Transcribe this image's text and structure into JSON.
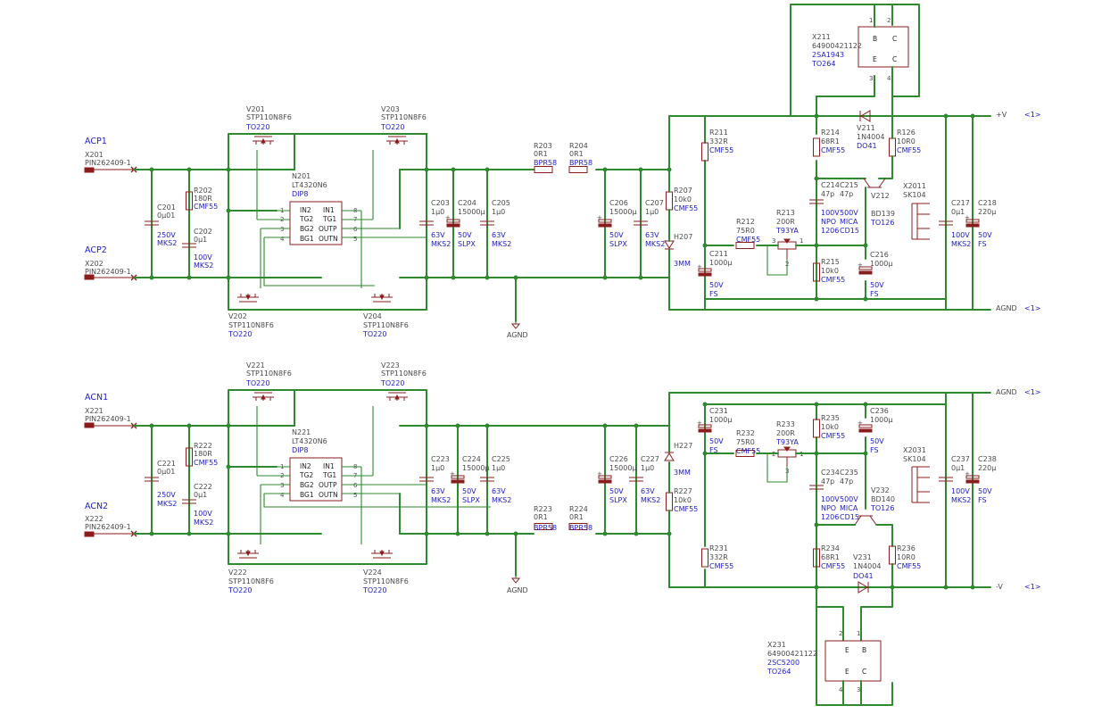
{
  "nets": {
    "acp1": "ACP1",
    "acp2": "ACP2",
    "acn1": "ACN1",
    "acn2": "ACN2",
    "pv": "+V",
    "nv": "-V",
    "agnd": "AGND",
    "ref": "<1>"
  },
  "connectors": {
    "x201": {
      "ref": "X201",
      "val": "PIN262409-1"
    },
    "x202": {
      "ref": "X202",
      "val": "PIN262409-1"
    },
    "x221": {
      "ref": "X221",
      "val": "PIN262409-1"
    },
    "x222": {
      "ref": "X222",
      "val": "PIN262409-1"
    }
  },
  "top": {
    "c201": {
      "ref": "C201",
      "val": "0µ01",
      "v": "250V",
      "t": "MKS2"
    },
    "r202": {
      "ref": "R202",
      "val": "180R",
      "t": "CMF55"
    },
    "c202": {
      "ref": "C202",
      "val": "0µ1",
      "v": "100V",
      "t": "MKS2"
    },
    "v201": {
      "ref": "V201",
      "val": "STP110N8F6",
      "t": "TO220"
    },
    "v202": {
      "ref": "V202",
      "val": "STP110N8F6",
      "t": "TO220"
    },
    "v203": {
      "ref": "V203",
      "val": "STP110N8F6",
      "t": "TO220"
    },
    "v204": {
      "ref": "V204",
      "val": "STP110N8F6",
      "t": "TO220"
    },
    "n201": {
      "ref": "N201",
      "val": "LT4320N6",
      "t": "DIP8",
      "pins": [
        "IN2",
        "TG2",
        "BG2",
        "BG1",
        "IN1",
        "TG1",
        "OUTP",
        "OUTN"
      ],
      "nums": [
        "1",
        "2",
        "3",
        "4",
        "8",
        "7",
        "6",
        "5"
      ]
    },
    "c203": {
      "ref": "C203",
      "val": "1µ0",
      "v": "63V",
      "t": "MKS2"
    },
    "c204": {
      "ref": "C204",
      "val": "15000µ",
      "v": "50V",
      "t": "SLPX"
    },
    "c205": {
      "ref": "C205",
      "val": "1µ0",
      "v": "63V",
      "t": "MKS2"
    },
    "r203": {
      "ref": "R203",
      "val": "0R1",
      "t": "BPR58"
    },
    "r204": {
      "ref": "R204",
      "val": "0R1",
      "t": "BPR58"
    },
    "c206": {
      "ref": "C206",
      "val": "15000µ",
      "v": "50V",
      "t": "SLPX"
    },
    "c207": {
      "ref": "C207",
      "val": "1µ0",
      "v": "63V",
      "t": "MKS2"
    },
    "r207": {
      "ref": "R207",
      "val": "10k0",
      "t": "CMF55"
    },
    "h207": {
      "ref": "H207",
      "t": "3MM"
    },
    "r211": {
      "ref": "R211",
      "val": "332R",
      "t": "CMF55"
    },
    "c211": {
      "ref": "C211",
      "val": "1000µ",
      "v": "50V",
      "t": "FS"
    },
    "r212": {
      "ref": "R212",
      "val": "75R0",
      "t": "CMF55"
    },
    "r213": {
      "ref": "R213",
      "val": "200R",
      "t": "T93YA"
    },
    "r214": {
      "ref": "R214",
      "val": "68R1",
      "t": "CMF55"
    },
    "r215": {
      "ref": "R215",
      "val": "10k0",
      "t": "CMF55"
    },
    "c214": {
      "ref": "C214",
      "val": "47p",
      "v": "100V",
      "t": "NPO",
      "p": "1206"
    },
    "c215": {
      "ref": "C215",
      "val": "47p",
      "v": "500V",
      "t": "MICA",
      "p": "CD15"
    },
    "v211": {
      "ref": "V211",
      "val": "1N4004",
      "t": "DO41"
    },
    "r126": {
      "ref": "R126",
      "val": "10R0",
      "t": "CMF55"
    },
    "v212": {
      "ref": "V212",
      "val": "BD139",
      "t": "TO126"
    },
    "c216": {
      "ref": "C216",
      "val": "1000µ",
      "v": "50V",
      "t": "FS"
    },
    "x2011": {
      "ref": "X2011",
      "val": "SK104"
    },
    "c217": {
      "ref": "C217",
      "val": "0µ1",
      "v": "100V",
      "t": "MKS2"
    },
    "c218": {
      "ref": "C218",
      "val": "220µ",
      "v": "50V",
      "t": "FS"
    },
    "x211": {
      "ref": "X211",
      "val": "64900421122",
      "p": "2SA1943",
      "t": "TO264"
    }
  },
  "bot": {
    "c221": {
      "ref": "C221",
      "val": "0µ01",
      "v": "250V",
      "t": "MKS2"
    },
    "r222": {
      "ref": "R222",
      "val": "180R",
      "t": "CMF55"
    },
    "c222": {
      "ref": "C222",
      "val": "0µ1",
      "v": "100V",
      "t": "MKS2"
    },
    "v221": {
      "ref": "V221",
      "val": "STP110N8F6",
      "t": "TO220"
    },
    "v222": {
      "ref": "V222",
      "val": "STP110N8F6",
      "t": "TO220"
    },
    "v223": {
      "ref": "V223",
      "val": "STP110N8F6",
      "t": "TO220"
    },
    "v224": {
      "ref": "V224",
      "val": "STP110N8F6",
      "t": "TO220"
    },
    "n221": {
      "ref": "N221",
      "val": "LT4320N6",
      "t": "DIP8",
      "pins": [
        "IN2",
        "TG2",
        "BG2",
        "BG1",
        "IN1",
        "TG1",
        "OUTP",
        "OUTN"
      ],
      "nums": [
        "1",
        "2",
        "3",
        "4",
        "8",
        "7",
        "6",
        "5"
      ]
    },
    "c223": {
      "ref": "C223",
      "val": "1µ0",
      "v": "63V",
      "t": "MKS2"
    },
    "c224": {
      "ref": "C224",
      "val": "15000µ",
      "v": "50V",
      "t": "SLPX"
    },
    "c225": {
      "ref": "C225",
      "val": "1µ0",
      "v": "63V",
      "t": "MKS2"
    },
    "r223": {
      "ref": "R223",
      "val": "0R1",
      "t": "BPR58"
    },
    "r224": {
      "ref": "R224",
      "val": "0R1",
      "t": "BPR58"
    },
    "c226": {
      "ref": "C226",
      "val": "15000µ",
      "v": "50V",
      "t": "SLPX"
    },
    "c227": {
      "ref": "C227",
      "val": "1µ0",
      "v": "63V",
      "t": "MKS2"
    },
    "r227": {
      "ref": "R227",
      "val": "10k0",
      "t": "CMF55"
    },
    "h227": {
      "ref": "H227",
      "t": "3MM"
    },
    "c231": {
      "ref": "C231",
      "val": "1000µ",
      "v": "50V",
      "t": "FS"
    },
    "r232": {
      "ref": "R232",
      "val": "75R0",
      "t": "CMF55"
    },
    "r233": {
      "ref": "R233",
      "val": "200R",
      "t": "T93YA"
    },
    "r235": {
      "ref": "R235",
      "val": "10k0",
      "t": "CMF55"
    },
    "c236": {
      "ref": "C236",
      "val": "1000µ",
      "v": "50V",
      "t": "FS"
    },
    "x2031": {
      "ref": "X2031",
      "val": "SK104"
    },
    "c237": {
      "ref": "C237",
      "val": "0µ1",
      "v": "100V",
      "t": "MKS2"
    },
    "c238": {
      "ref": "C238",
      "val": "220µ",
      "v": "50V",
      "t": "FS"
    },
    "c234": {
      "ref": "C234",
      "val": "47p",
      "v": "100V",
      "t": "NPO",
      "p": "1206"
    },
    "c235": {
      "ref": "C235",
      "val": "47p",
      "v": "500V",
      "t": "MICA",
      "p": "CD15"
    },
    "v232": {
      "ref": "V232",
      "val": "BD140",
      "t": "TO126"
    },
    "r231": {
      "ref": "R231",
      "val": "332R",
      "t": "CMF55"
    },
    "r234": {
      "ref": "R234",
      "val": "68R1",
      "t": "CMF55"
    },
    "v231": {
      "ref": "V231",
      "val": "1N4004",
      "t": "DO41"
    },
    "r236": {
      "ref": "R236",
      "val": "10R0",
      "t": "CMF55"
    },
    "x231": {
      "ref": "X231",
      "val": "64900421122",
      "p": "2SC5200",
      "t": "TO264"
    }
  },
  "pins": {
    "b": "B",
    "c": "C",
    "e": "E",
    "n1": "1",
    "n2": "2",
    "n3": "3",
    "n4": "4"
  }
}
